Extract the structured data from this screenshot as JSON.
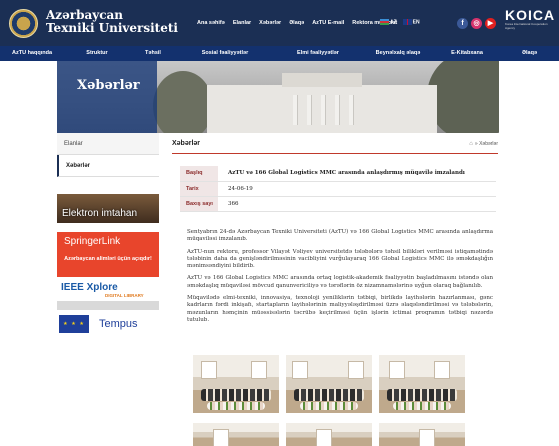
{
  "header": {
    "university_name_line1": "Azərbaycan",
    "university_name_line2": "Texniki Universiteti",
    "top_links": [
      "Ana səhifə",
      "Elanlar",
      "Xəbərlər",
      "Əlaqə",
      "AzTU E-mail",
      "Rektora müraciət"
    ],
    "languages": [
      "AZ",
      "EN"
    ],
    "social": {
      "facebook": "f",
      "instagram": "◎",
      "youtube": "▶"
    },
    "partner_logo": "KOICA",
    "partner_subtitle": "Korea International Cooperation Agency"
  },
  "main_nav": [
    "AzTU haqqında",
    "Struktur",
    "Təhsil",
    "Sosial fəaliyyətlər",
    "Elmi fəaliyyətlər",
    "Beynəlxalq əlaqə",
    "E-Kitabxana",
    "Əlaqə"
  ],
  "banner": {
    "title": "Xəbərlər"
  },
  "sidebar": {
    "items": [
      {
        "label": "Elanlar",
        "active": false
      },
      {
        "label": "Xəbərlər",
        "active": true
      }
    ],
    "promos": {
      "elektron": "Elektron imtahan",
      "springer": "SpringerLink",
      "alimler": "Azərbaycan alimləri üçün açıqdır!",
      "ieee_title": "IEEE Xplore",
      "ieee_sub": "DIGITAL LIBRARY",
      "eu_stars": "★ ★ ★",
      "tempus": "Tempus"
    }
  },
  "content": {
    "title": "Xəbərlər",
    "breadcrumb": "Xəbərlər",
    "info": [
      {
        "key": "Başlıq",
        "value": "AzTU və 166 Global Logistics MMC arasında anlaşdırmış müqavilə imzalandı"
      },
      {
        "key": "Tarix",
        "value": "24-06-19"
      },
      {
        "key": "Baxış sayı",
        "value": "366"
      }
    ],
    "paragraphs": [
      "Sentyabrın 24-də Azərbaycan Texniki Universiteti (AzTU) və 166 Global Logistics MMC arasında anlaşdırma müqaviləsi imzalanıb.",
      "AzTU-nun rektoru, professor Vilayət Vəliyev universitetdə tələbələrə təhsil bilikləri verilməsi istiqamətində tələbinin daha da genişləndirilməsinin vacibliyini vurğulayaraq 166 Global Logistics MMC ilə əməkdaşlığın mənimsəndiyini bildirib.",
      "AzTU və 166 Global Logistics MMC arasında ortaq logistik-akademik fəaliyyətin başladılmasını istəndə olan əməkdaşlıq müqaviləsi mövcud qanunvericiliyə və tərəflərin öz nizamnamələrinə uyğun olaraq bağlanılıb.",
      "Müqavilədə elmi-texniki, innovasiya, texnoloji yeniliklərin tətbiqi, birlikdə layihələrin hazırlanması, gənc kadrların fərdi inkişafı, startapların layihələrinin maliyyələşdirilməsi üzrə əlaqələndirilməsi və tələbələrin, məzunların həmçinin müəssisələrin təcrübə keçirilməsi üçün işlərin ictimai proqramın tətbiqi nəzərdə tutulub."
    ]
  }
}
